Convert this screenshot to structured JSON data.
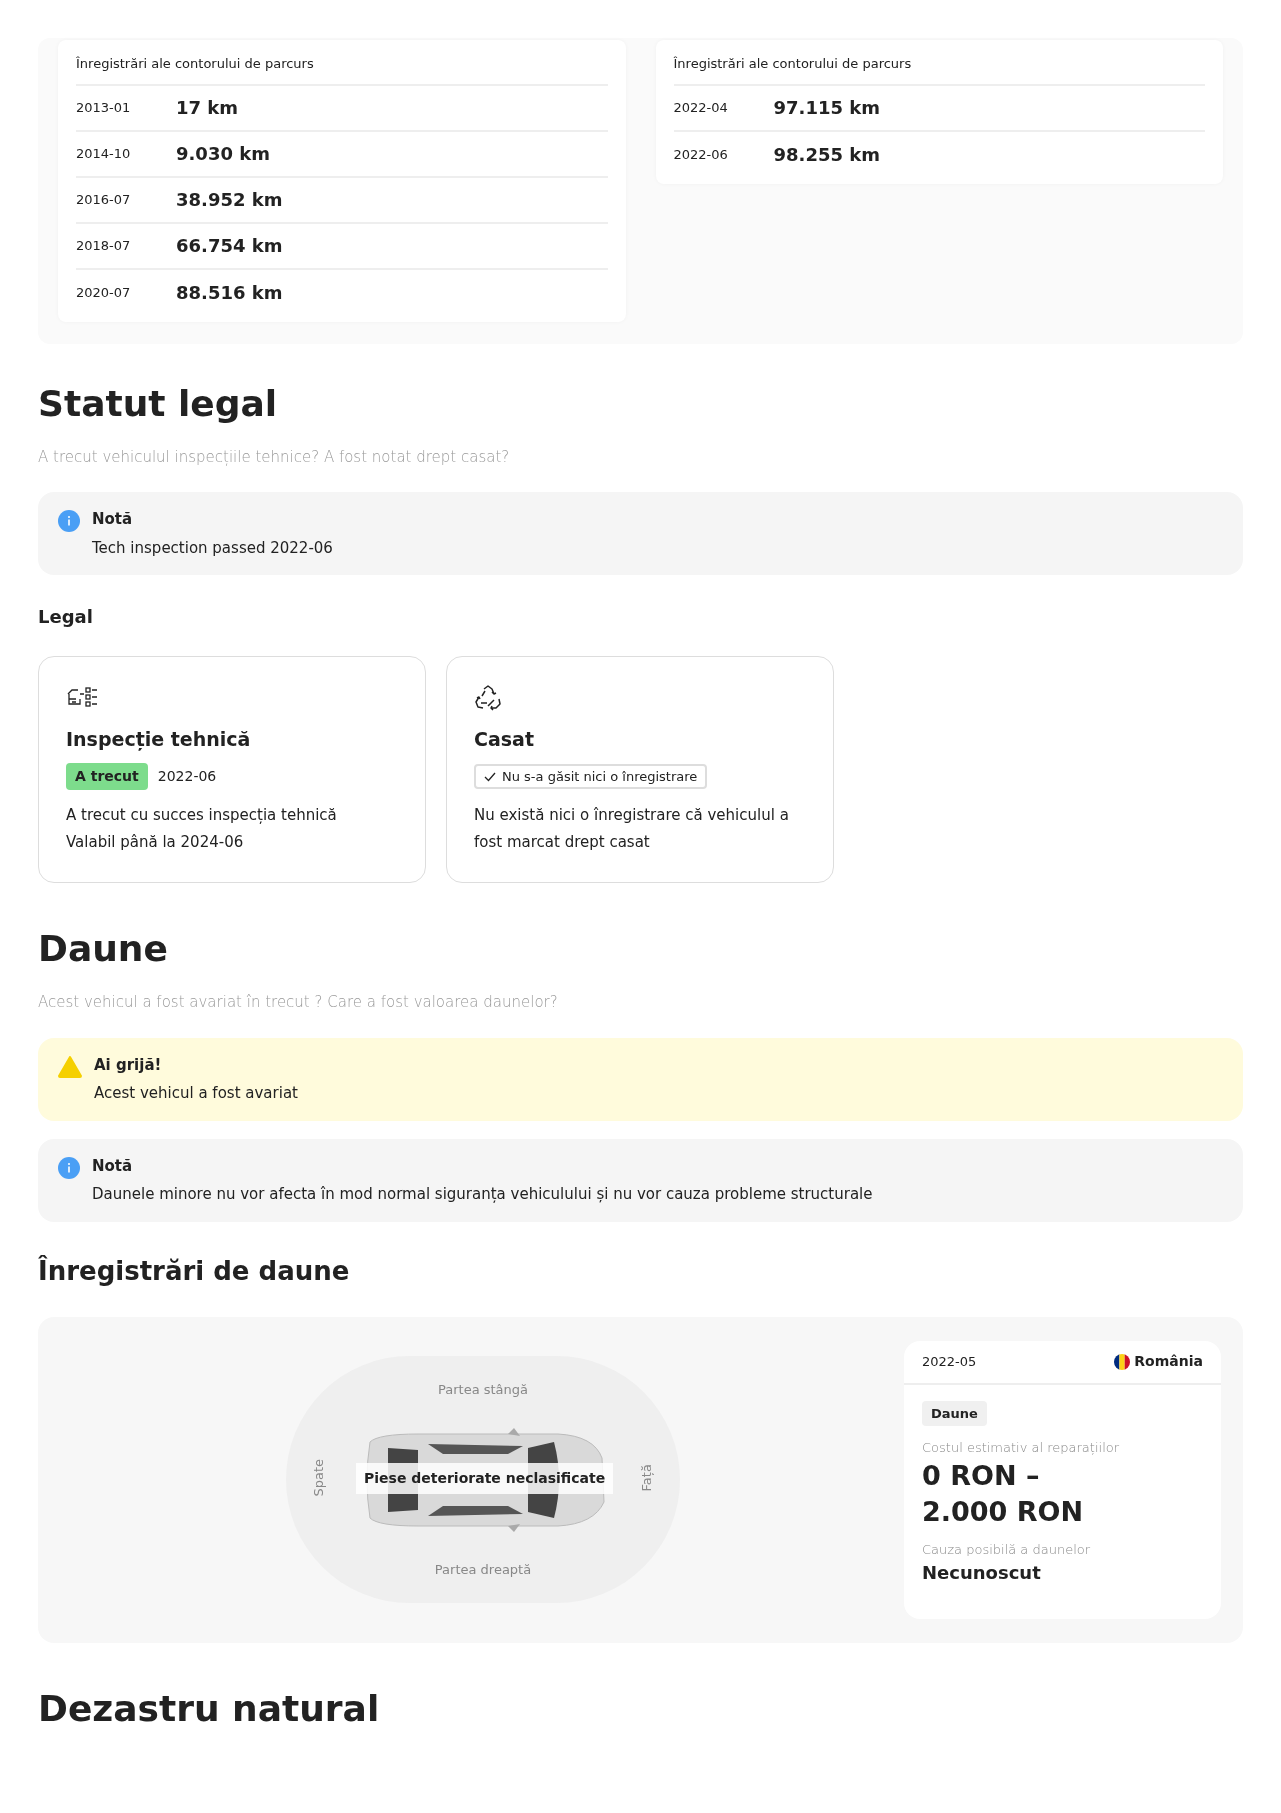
{
  "odometer_panels": [
    {
      "title": "Înregistrări ale contorului de parcurs",
      "records": [
        {
          "date": "2013-01",
          "mileage": "17 km"
        },
        {
          "date": "2014-10",
          "mileage": "9.030 km"
        },
        {
          "date": "2016-07",
          "mileage": "38.952 km"
        },
        {
          "date": "2018-07",
          "mileage": "66.754 km"
        },
        {
          "date": "2020-07",
          "mileage": "88.516 km"
        }
      ]
    },
    {
      "title": "Înregistrări ale contorului de parcurs",
      "records": [
        {
          "date": "2022-04",
          "mileage": "97.115 km"
        },
        {
          "date": "2022-06",
          "mileage": "98.255 km"
        }
      ]
    }
  ],
  "legal_section": {
    "heading": "Statut legal",
    "subtitle": "A trecut vehiculul inspecțiile tehnice? A fost notat drept casat?",
    "note": {
      "kind": "info",
      "title": "Notă",
      "text": "Tech inspection passed 2022-06"
    },
    "subheading": "Legal",
    "cards": [
      {
        "kind": "inspection",
        "title": "Inspecție tehnică",
        "badge": {
          "kind": "passed",
          "label": "A trecut"
        },
        "date": "2022-06",
        "description": [
          "A trecut cu succes inspecția tehnică",
          "Valabil până la 2024-06"
        ]
      },
      {
        "kind": "scrapped",
        "title": "Casat",
        "badge": {
          "kind": "none_found",
          "label": "Nu s-a găsit nici o înregistrare"
        },
        "description": [
          "Nu există nici o înregistrare că vehiculul a fost marcat drept casat"
        ]
      }
    ]
  },
  "damage_section": {
    "heading": "Daune",
    "subtitle": "Acest vehicul a fost avariat în trecut ? Care a fost valoarea daunelor?",
    "alerts": [
      {
        "kind": "warning",
        "title": "Ai grijă!",
        "text": "Acest vehicul a fost avariat"
      },
      {
        "kind": "info",
        "title": "Notă",
        "text": "Daunele minore nu vor afecta în mod normal siguranța vehiculului și nu vor cauza probleme structurale"
      }
    ],
    "records_heading": "Înregistrări de daune",
    "diagram": {
      "left_label": "Partea stângă",
      "right_label": "Partea dreaptă",
      "rear_label": "Spate",
      "front_label": "Față",
      "damage_label": "Piese deteriorate neclasificate"
    },
    "record_card": {
      "date": "2022-05",
      "country": "România",
      "tag": "Daune",
      "cost_label": "Costul estimativ al reparațiilor",
      "cost_value": "0 RON – 2.000 RON",
      "cause_label": "Cauza posibilă a daunelor",
      "cause_value": "Necunoscut"
    }
  },
  "natural_disaster_section": {
    "heading": "Dezastru natural"
  }
}
